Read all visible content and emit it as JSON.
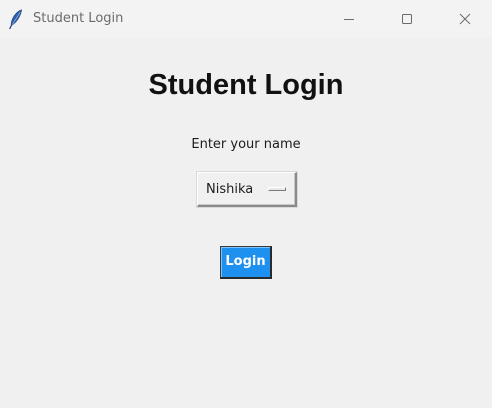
{
  "window": {
    "title": "Student Login",
    "icon": "feather-icon",
    "controls": [
      "minimize-icon",
      "maximize-icon",
      "close-icon"
    ]
  },
  "form": {
    "heading": "Student Login",
    "prompt": "Enter your name",
    "name_select": {
      "selected": "Nishika"
    },
    "login_label": "Login"
  },
  "colors": {
    "background": "#f0f0f0",
    "login_button": "#1e90f0",
    "login_text": "#ffffff",
    "heading_text": "#111111"
  }
}
